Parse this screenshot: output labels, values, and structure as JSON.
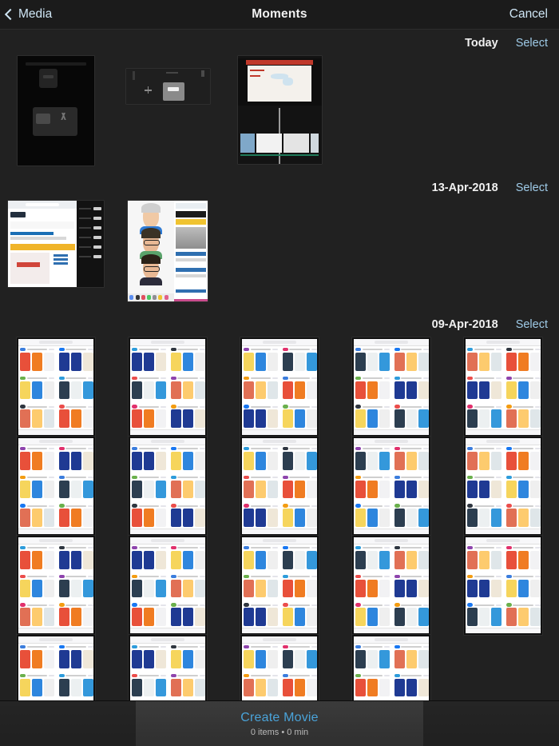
{
  "navbar": {
    "back_label": "Media",
    "title": "Moments",
    "cancel_label": "Cancel"
  },
  "sections": [
    {
      "date": "Today",
      "select_label": "Select"
    },
    {
      "date": "13-Apr-2018",
      "select_label": "Select"
    },
    {
      "date": "09-Apr-2018",
      "select_label": "Select"
    }
  ],
  "bottom_bar": {
    "action_label": "Create Movie",
    "status": "0 items • 0 min",
    "item_count": 0,
    "duration_min": 0
  },
  "colors": {
    "background": "#212121",
    "navbar": "#1b1b1b",
    "accent_blue": "#4aa3d9",
    "link_blue": "#9fcbe8",
    "bottom_bar": "#3b3b3b",
    "text_primary": "#f0f0f0"
  },
  "grid": {
    "today_count": 3,
    "apr13_count": 2,
    "apr09_rows": 4,
    "apr09_columns": 5,
    "apr09_last_row_count": 4
  }
}
